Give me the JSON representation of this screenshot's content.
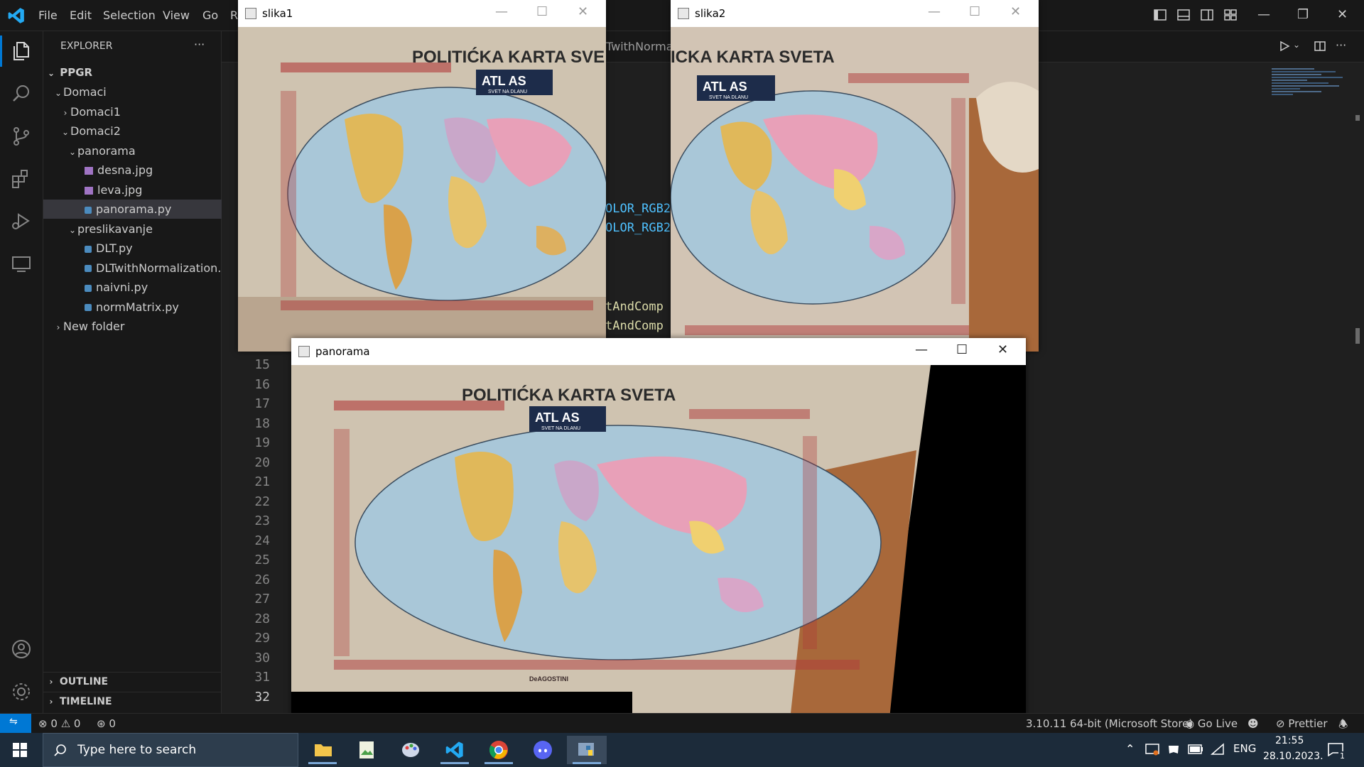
{
  "titlebar": {
    "menu": [
      "File",
      "Edit",
      "Selection",
      "View",
      "Go",
      "R"
    ]
  },
  "explorer": {
    "title": "EXPLORER",
    "more": "···",
    "root": "PPGR",
    "items": [
      {
        "label": "Domaci",
        "kind": "folder-open"
      },
      {
        "label": "Domaci1",
        "kind": "folder-closed"
      },
      {
        "label": "Domaci2",
        "kind": "folder-open"
      },
      {
        "label": "panorama",
        "kind": "folder-open"
      },
      {
        "label": "desna.jpg",
        "kind": "image"
      },
      {
        "label": "leva.jpg",
        "kind": "image"
      },
      {
        "label": "panorama.py",
        "kind": "python",
        "selected": true
      },
      {
        "label": "preslikavanje",
        "kind": "folder-open"
      },
      {
        "label": "DLT.py",
        "kind": "python"
      },
      {
        "label": "DLTwithNormalization.py",
        "kind": "python"
      },
      {
        "label": "naivni.py",
        "kind": "python"
      },
      {
        "label": "normMatrix.py",
        "kind": "python"
      },
      {
        "label": "New folder",
        "kind": "folder-closed"
      }
    ],
    "outline": "OUTLINE",
    "timeline": "TIMELINE"
  },
  "editor": {
    "tab_fragment": "TwithNormal",
    "code_fragments": [
      "OLOR_RGB2",
      "OLOR_RGB2",
      "tAndComp",
      "tAndComp"
    ],
    "line_numbers": [
      "15",
      "16",
      "17",
      "18",
      "19",
      "20",
      "21",
      "22",
      "23",
      "24",
      "25",
      "26",
      "27",
      "28",
      "29",
      "30",
      "31",
      "32"
    ],
    "active_line": "32"
  },
  "windows": {
    "slika1": {
      "title": "slika1",
      "map_title": "POLITIĆKA KARTA SVE",
      "atlas": "ATL  AS",
      "atlas_sub": "SVET NA DLANU"
    },
    "slika2": {
      "title": "slika2",
      "map_title": "ICKA KARTA SVETA",
      "atlas": "ATL  AS",
      "atlas_sub": "SVET NA DLANU"
    },
    "panorama": {
      "title": "panorama",
      "map_title": "POLITIĆKA KARTA SVETA",
      "atlas": "ATL  AS",
      "atlas_sub": "SVET NA DLANU",
      "publisher": "DeAGOSTINI"
    }
  },
  "statusbar": {
    "errors": "0",
    "warnings": "0",
    "ports": "0",
    "python_version": "3.10.11 64-bit (Microsoft Store)",
    "go_live": "Go Live",
    "prettier": "Prettier"
  },
  "taskbar": {
    "search_placeholder": "Type here to search",
    "language": "ENG",
    "time": "21:55",
    "date": "28.10.2023.",
    "notification_count": "1"
  },
  "colors": {
    "accent": "#0078d4",
    "vscode_blue": "#23a9f2",
    "status_remote": "#0078d4"
  }
}
